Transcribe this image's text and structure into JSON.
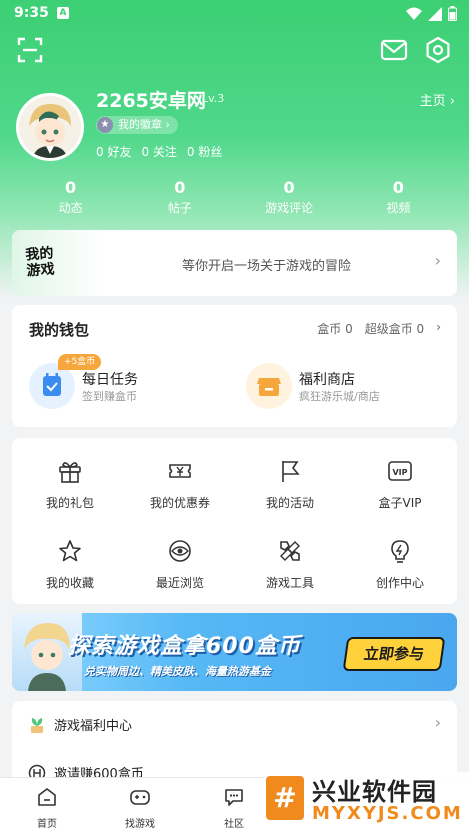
{
  "status_bar": {
    "time": "9:35",
    "notif_icon": "A"
  },
  "header": {
    "scan_icon": "scan-icon",
    "mail_icon": "mail-icon",
    "settings_icon": "settings-icon"
  },
  "profile": {
    "username": "2265安卓网",
    "level": "Lv.3",
    "homepage_label": "主页",
    "badge_label": "我的徽章",
    "friends": "0 好友",
    "following": "0 关注",
    "fans": "0 粉丝"
  },
  "stats": [
    {
      "value": "0",
      "label": "动态"
    },
    {
      "value": "0",
      "label": "帖子"
    },
    {
      "value": "0",
      "label": "游戏评论"
    },
    {
      "value": "0",
      "label": "视频"
    }
  ],
  "game_banner": {
    "logo_text": "我的游戏",
    "message": "等你开启一场关于游戏的冒险"
  },
  "wallet": {
    "title": "我的钱包",
    "coins": "盒币 0",
    "super_coins": "超级盒币 0",
    "daily_badge": "+5盒币",
    "daily_title": "每日任务",
    "daily_sub": "签到赚盒币",
    "shop_title": "福利商店",
    "shop_sub": "疯狂游乐城/商店"
  },
  "grid": [
    {
      "label": "我的礼包",
      "icon": "gift-icon"
    },
    {
      "label": "我的优惠券",
      "icon": "coupon-icon"
    },
    {
      "label": "我的活动",
      "icon": "flag-icon"
    },
    {
      "label": "盒子VIP",
      "icon": "vip-icon"
    },
    {
      "label": "我的收藏",
      "icon": "star-icon"
    },
    {
      "label": "最近浏览",
      "icon": "eye-icon"
    },
    {
      "label": "游戏工具",
      "icon": "tool-icon"
    },
    {
      "label": "创作中心",
      "icon": "bulb-icon"
    }
  ],
  "promo": {
    "headline": "探索游戏盒拿600盒币",
    "subline": "兑实物周边、精美皮肤、海量热游基金",
    "button": "立即参与"
  },
  "welfare": {
    "center": "游戏福利中心",
    "invite": "邀请赚600盒币"
  },
  "tabs": [
    {
      "label": "首页",
      "icon": "home-icon"
    },
    {
      "label": "找游戏",
      "icon": "gamepad-icon"
    },
    {
      "label": "社区",
      "icon": "chat-icon"
    }
  ],
  "watermark": {
    "name": "兴业软件园",
    "url": "MYXYJS.COM"
  },
  "colors": {
    "brand_green": "#3ccf73",
    "promo_blue": "#4aa7ef",
    "promo_yellow": "#ffd23c",
    "coin_orange": "#f7a63c"
  }
}
